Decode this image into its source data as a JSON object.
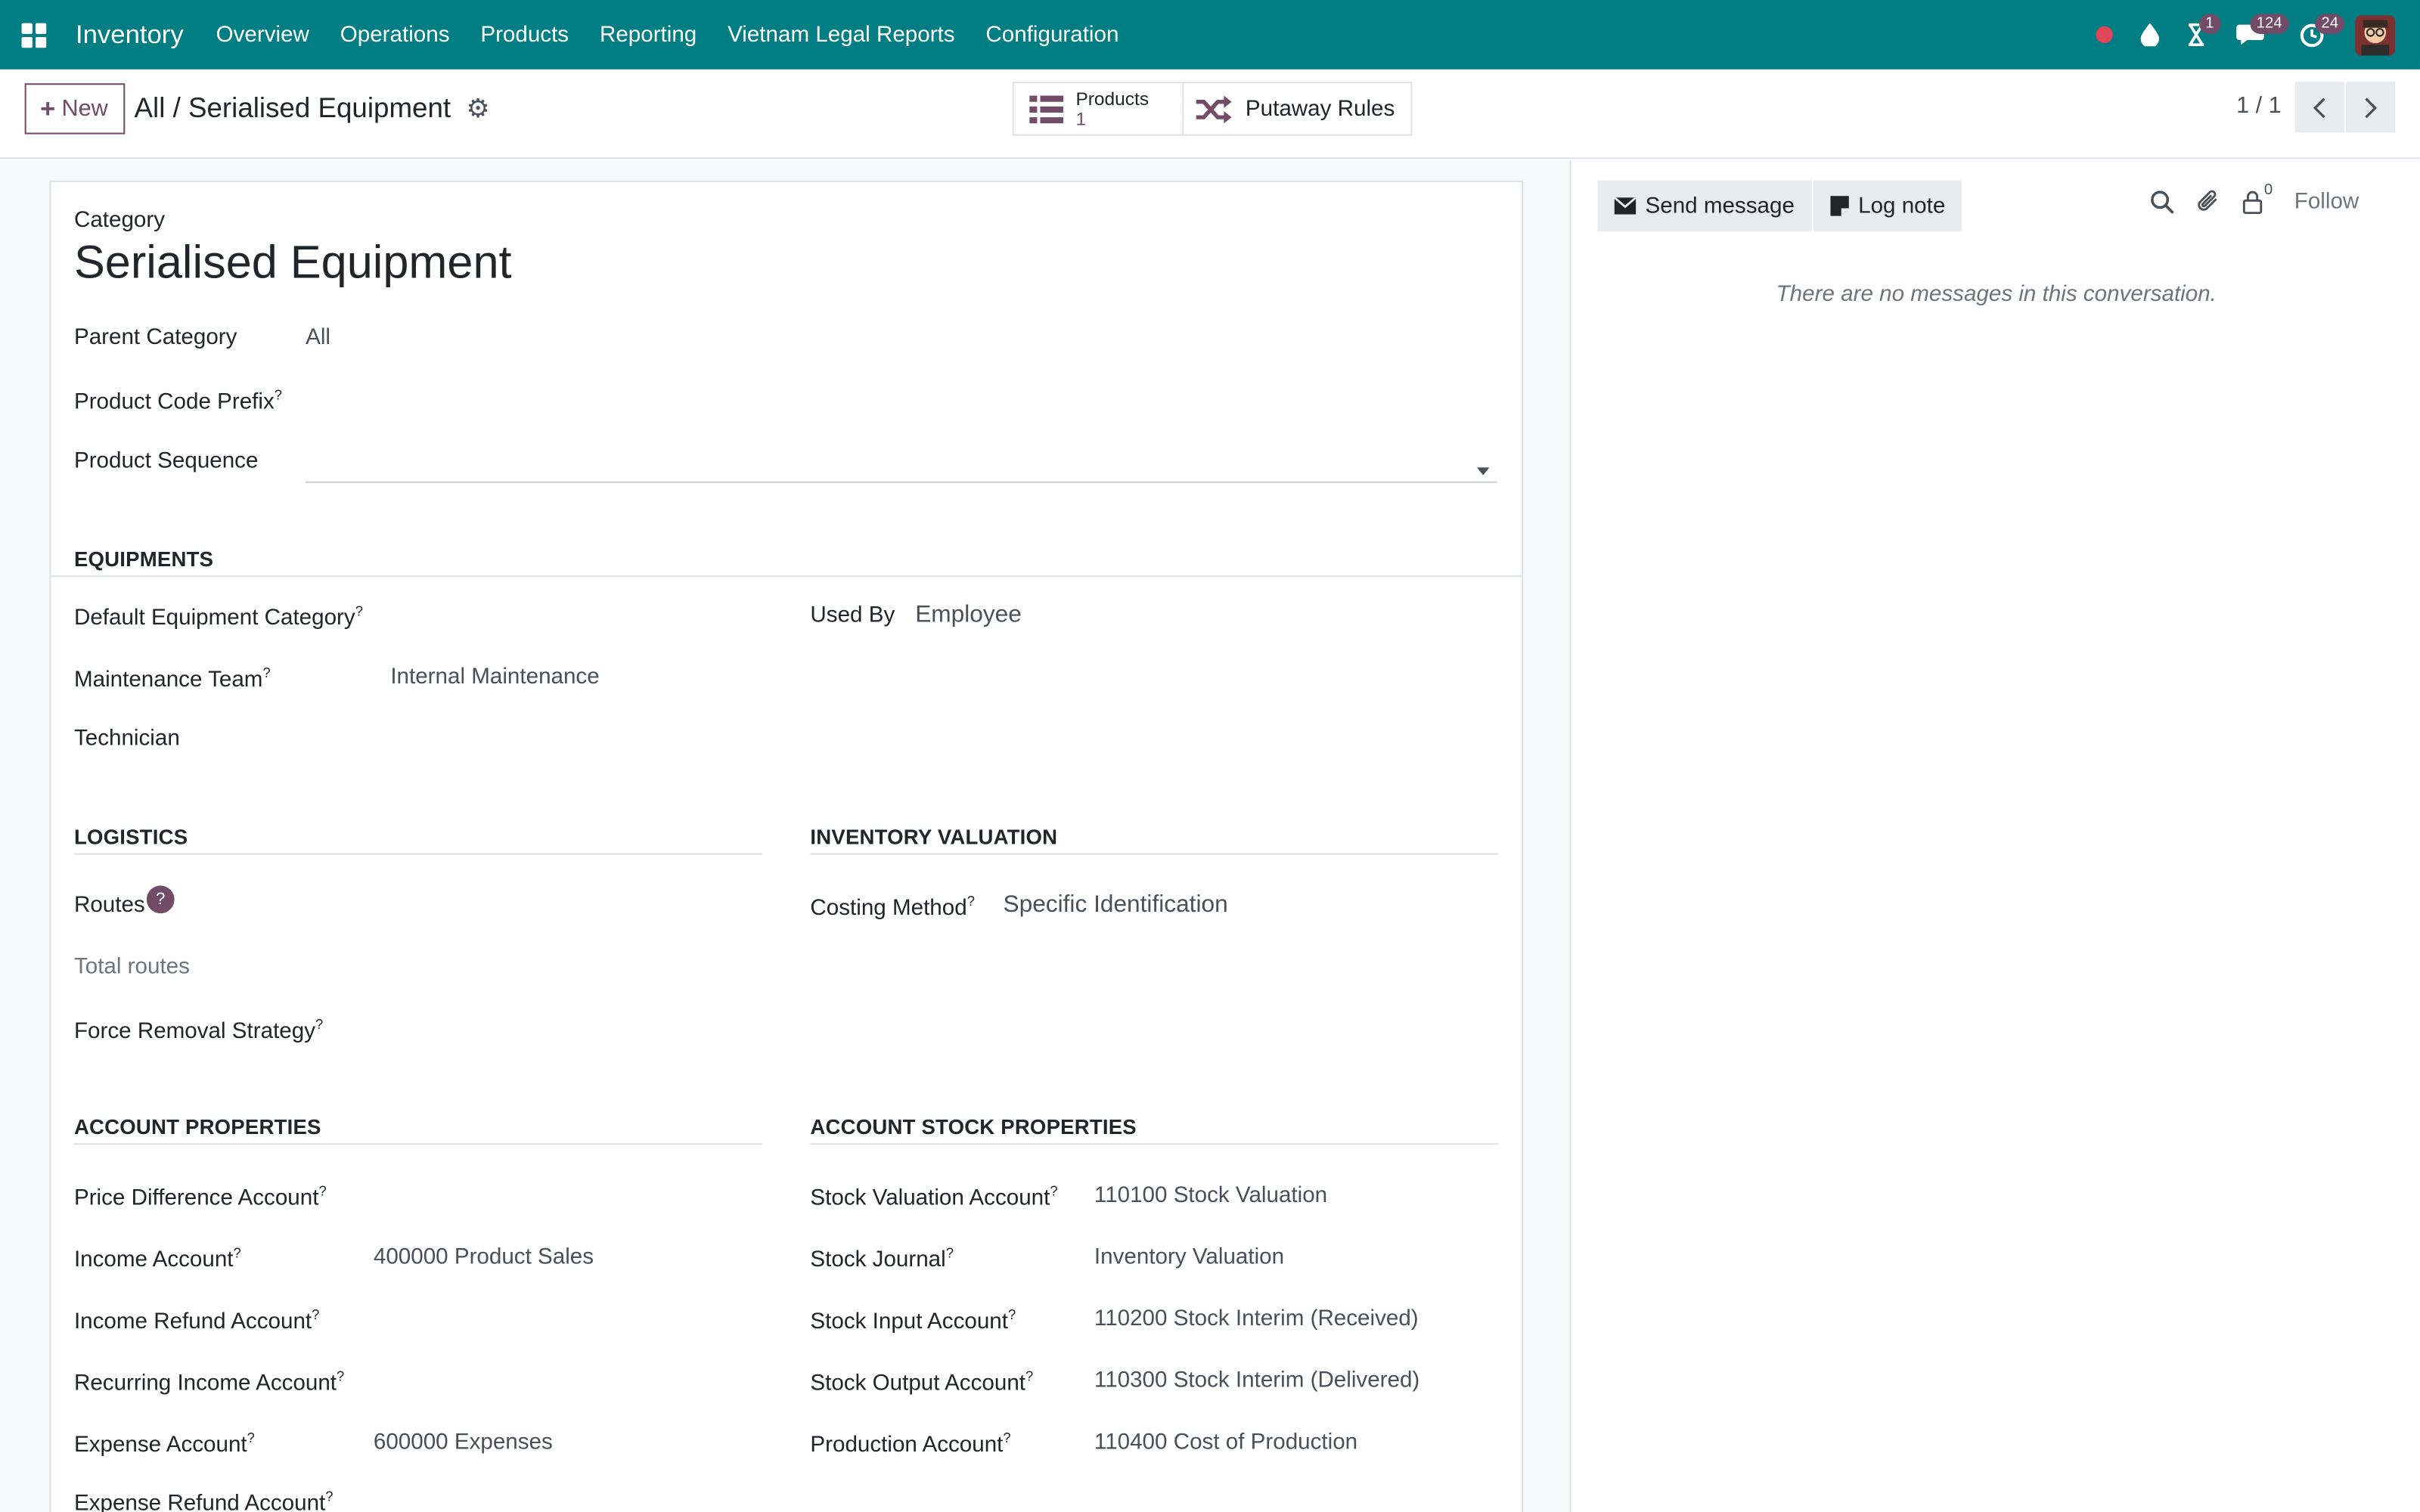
{
  "topnav": {
    "app_name": "Inventory",
    "menu": [
      "Overview",
      "Operations",
      "Products",
      "Reporting",
      "Vietnam Legal Reports",
      "Configuration"
    ],
    "activity_badge": "1",
    "messages_badge": "124",
    "timesheet_badge": "24"
  },
  "control": {
    "new_label": "New",
    "breadcrumb": "All / Serialised Equipment",
    "smart_products_label": "Products",
    "smart_products_count": "1",
    "smart_putaway_label": "Putaway Rules",
    "pager": "1 / 1"
  },
  "form": {
    "category_caption": "Category",
    "title": "Serialised Equipment",
    "parent_category_label": "Parent Category",
    "parent_category_value": "All",
    "product_code_prefix_label": "Product Code Prefix",
    "product_sequence_label": "Product Sequence",
    "help_mark": "?",
    "equipments": {
      "heading": "EQUIPMENTS",
      "default_category_label": "Default Equipment Category",
      "used_by_label": "Used By",
      "used_by_value": "Employee",
      "maintenance_team_label": "Maintenance Team",
      "maintenance_team_value": "Internal Maintenance",
      "technician_label": "Technician"
    },
    "logistics": {
      "heading": "LOGISTICS",
      "routes_label": "Routes",
      "total_routes_label": "Total routes",
      "force_removal_label": "Force Removal Strategy"
    },
    "valuation": {
      "heading": "INVENTORY VALUATION",
      "costing_method_label": "Costing Method",
      "costing_method_value": "Specific Identification"
    },
    "account_props": {
      "heading": "ACCOUNT PROPERTIES",
      "price_diff_label": "Price Difference Account",
      "income_label": "Income Account",
      "income_value": "400000 Product Sales",
      "income_refund_label": "Income Refund Account",
      "recurring_income_label": "Recurring Income Account",
      "expense_label": "Expense Account",
      "expense_value": "600000 Expenses",
      "expense_refund_label": "Expense Refund Account"
    },
    "stock_props": {
      "heading": "ACCOUNT STOCK PROPERTIES",
      "valuation_account_label": "Stock Valuation Account",
      "valuation_account_value": "110100 Stock Valuation",
      "journal_label": "Stock Journal",
      "journal_value": "Inventory Valuation",
      "input_label": "Stock Input Account",
      "input_value": "110200 Stock Interim (Received)",
      "output_label": "Stock Output Account",
      "output_value": "110300 Stock Interim (Delivered)",
      "production_label": "Production Account",
      "production_value": "110400 Cost of Production"
    }
  },
  "chatter": {
    "send_message": "Send message",
    "log_note": "Log note",
    "followers_count": "0",
    "follow": "Follow",
    "empty": "There are no messages in this conversation."
  },
  "colors": {
    "navbar": "#017e84",
    "brand_accent": "#714b67"
  }
}
